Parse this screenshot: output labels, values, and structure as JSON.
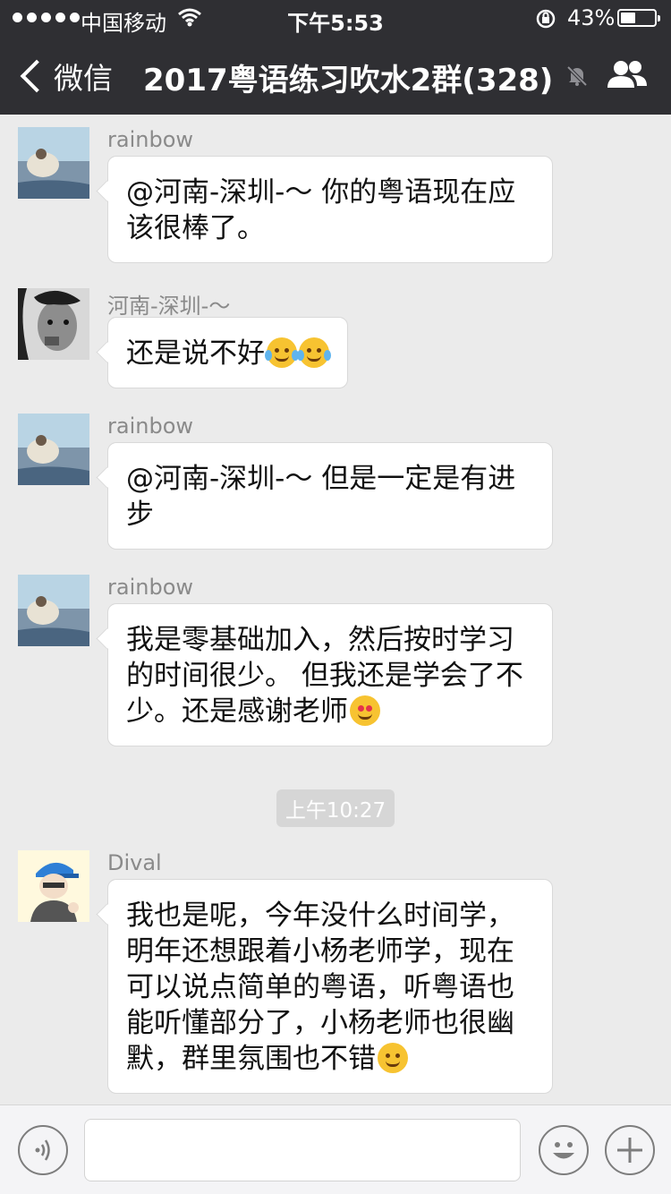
{
  "status_bar": {
    "carrier": "中国移动",
    "time": "下午5:53",
    "battery": "43%"
  },
  "nav": {
    "back_label": "微信",
    "title": "2017粤语练习吹水2群(328)"
  },
  "messages": [
    {
      "sender": "rainbow",
      "text": "@河南-深圳-～ 你的粤语现在应该很棒了。"
    },
    {
      "sender": "河南-深圳-～",
      "text": "还是说不好",
      "emoji": "😭😭"
    },
    {
      "sender": "rainbow",
      "text": "@河南-深圳-～ 但是一定是有进步"
    },
    {
      "sender": "rainbow",
      "text": "我是零基础加入，然后按时学习的时间很少。 但我还是学会了不少。还是感谢老师",
      "emoji": "😍"
    },
    {
      "sender": "Dival",
      "text": "我也是呢，今年没什么时间学，明年还想跟着小杨老师学，现在可以说点简单的粤语，听粤语也能听懂部分了，小杨老师也很幽默，群里氛围也不错",
      "emoji": "🤗"
    }
  ],
  "timestamp": "上午10:27",
  "input": {
    "value": "",
    "placeholder": ""
  },
  "icons": {
    "back": "chevron-left-icon",
    "mute": "mute-bell-icon",
    "group": "group-members-icon",
    "voice": "voice-icon",
    "emoji": "emoji-icon",
    "plus": "plus-icon"
  },
  "colors": {
    "header_bg": "#2f2f33",
    "chat_bg": "#ebebeb",
    "bubble_bg": "#ffffff"
  }
}
